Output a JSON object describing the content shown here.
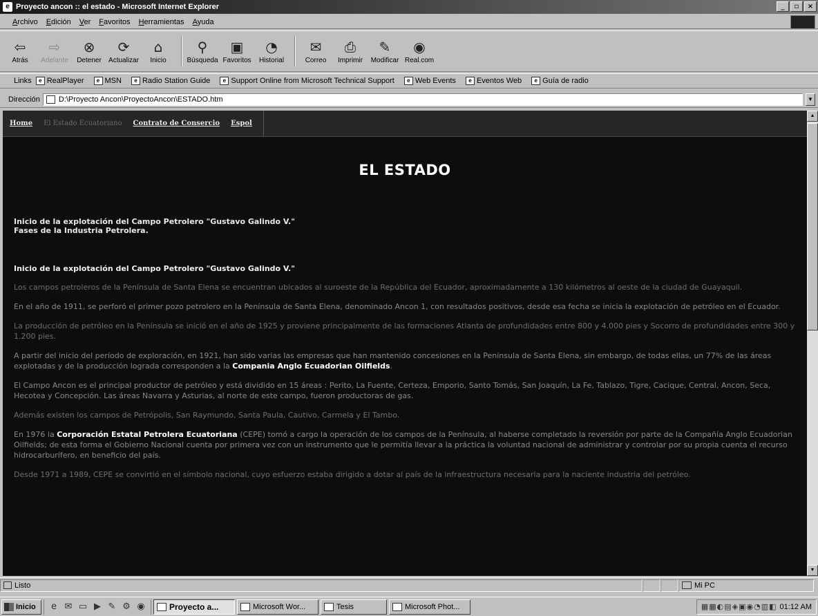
{
  "window": {
    "title": "Proyecto ancon :: el estado - Microsoft Internet Explorer",
    "controls": [
      "_",
      "▫",
      "×"
    ]
  },
  "menu": [
    "Archivo",
    "Edición",
    "Ver",
    "Favoritos",
    "Herramientas",
    "Ayuda"
  ],
  "toolbar": [
    {
      "label": "Atrás",
      "icon": "back-arrow-icon",
      "glyph": "⇦",
      "enabled": true
    },
    {
      "label": "Adelante",
      "icon": "forward-arrow-icon",
      "glyph": "⇨",
      "enabled": false
    },
    {
      "label": "Detener",
      "icon": "stop-icon",
      "glyph": "⊗",
      "enabled": true
    },
    {
      "label": "Actualizar",
      "icon": "refresh-icon",
      "glyph": "⟳",
      "enabled": true
    },
    {
      "label": "Inicio",
      "icon": "home-icon",
      "glyph": "⌂",
      "enabled": true
    },
    {
      "label": "Búsqueda",
      "icon": "search-icon",
      "glyph": "⚲",
      "enabled": true
    },
    {
      "label": "Favoritos",
      "icon": "favorites-icon",
      "glyph": "▣",
      "enabled": true
    },
    {
      "label": "Historial",
      "icon": "history-icon",
      "glyph": "◔",
      "enabled": true
    },
    {
      "label": "Correo",
      "icon": "mail-icon",
      "glyph": "✉",
      "enabled": true
    },
    {
      "label": "Imprimir",
      "icon": "print-icon",
      "glyph": "⎙",
      "enabled": true
    },
    {
      "label": "Modificar",
      "icon": "edit-icon",
      "glyph": "✎",
      "enabled": true
    },
    {
      "label": "Real.com",
      "icon": "real-icon",
      "glyph": "◉",
      "enabled": true
    }
  ],
  "links": {
    "label": "Links",
    "items": [
      "RealPlayer",
      "MSN",
      "Radio Station Guide",
      "Support Online from Microsoft Technical Support",
      "Web Events",
      "Eventos Web",
      "Guía de radio"
    ]
  },
  "address": {
    "label": "Dirección",
    "value": "D:\\Proyecto Ancon\\ProyectoAncon\\ESTADO.htm"
  },
  "page": {
    "nav": [
      "Home",
      "El Estado Ecuatoriano",
      "Contrato de Consercio",
      "Espol"
    ],
    "heading": "EL ESTADO",
    "toc": [
      "Inicio de la explotación del Campo Petrolero \"Gustavo Galindo V.\"",
      "Fases de la Industria Petrolera."
    ],
    "section_title": "Inicio de la explotación del Campo Petrolero \"Gustavo Galindo V.\"",
    "p1": "Los campos petroleros de la Península de Santa Elena se encuentran ubicados al suroeste de la República del Ecuador, aproximadamente a 130 kilómetros al oeste de la ciudad de Guayaquil.",
    "p2": "En el año de 1911, se perforó el primer pozo petrolero en la Península de Santa Elena, denominado Ancon 1, con resultados positivos, desde esa fecha se inicia la explotación de petróleo en el Ecuador.",
    "p3": "La producción de petróleo en la Península se inició en el año de 1925 y proviene principalmente de las formaciones Atlanta de profundidades entre 800 y 4.000 pies y Socorro de profundidades entre 300 y 1.200 pies.",
    "p4_before": "A partir del inicio del período de exploración, en 1921, han sido varias las empresas que han mantenido concesiones en la Península de Santa Elena, sin embargo, de todas ellas, un 77% de las áreas explotadas y de la producción lograda corresponden a la ",
    "p4_bold": "Compania Anglo Ecuadorian Oilfields",
    "p4_after": ".",
    "p5": "El Campo Ancon es el principal productor de petróleo y está dividido en 15 áreas : Perito, La Fuente, Certeza, Emporio, Santo Tomás, San Joaquín, La Fe, Tablazo, Tigre, Cacique, Central, Ancon, Seca, Hecotea y Concepción. Las áreas Navarra y Asturias, al norte de este campo, fueron productoras de gas.",
    "p6": "Además existen los campos de Petrópolis, San Raymundo, Santa Paula, Cautivo, Carmela y El Tambo.",
    "p7_before": "En 1976 la ",
    "p7_bold": "Corporación Estatal Petrolera Ecuatoriana",
    "p7_after": " (CEPE) tomó a cargo la operación de los campos de la Península, al haberse completado la reversión por parte de la Compañía Anglo Ecuadorian Oilfields; de esta forma el Gobierno Nacional cuenta por primera vez con un instrumento que le permitía llevar a la práctica la voluntad nacional de administrar y controlar por su propia cuenta el recurso hidrocarburífero, en beneficio del país.",
    "p8": "Desde 1971 a 1989, CEPE se convirtió en el símbolo nacional, cuyo esfuerzo estaba dirigido a dotar al país de la infraestructura necesaria para la naciente industria del petróleo."
  },
  "status": {
    "text": "Listo",
    "zone": "Mi PC"
  },
  "taskbar": {
    "start": "Inicio",
    "tasks": [
      "Proyecto a...",
      "Microsoft Wor...",
      "Tesis",
      "Microsoft Phot..."
    ],
    "clock": "01:12 AM"
  }
}
